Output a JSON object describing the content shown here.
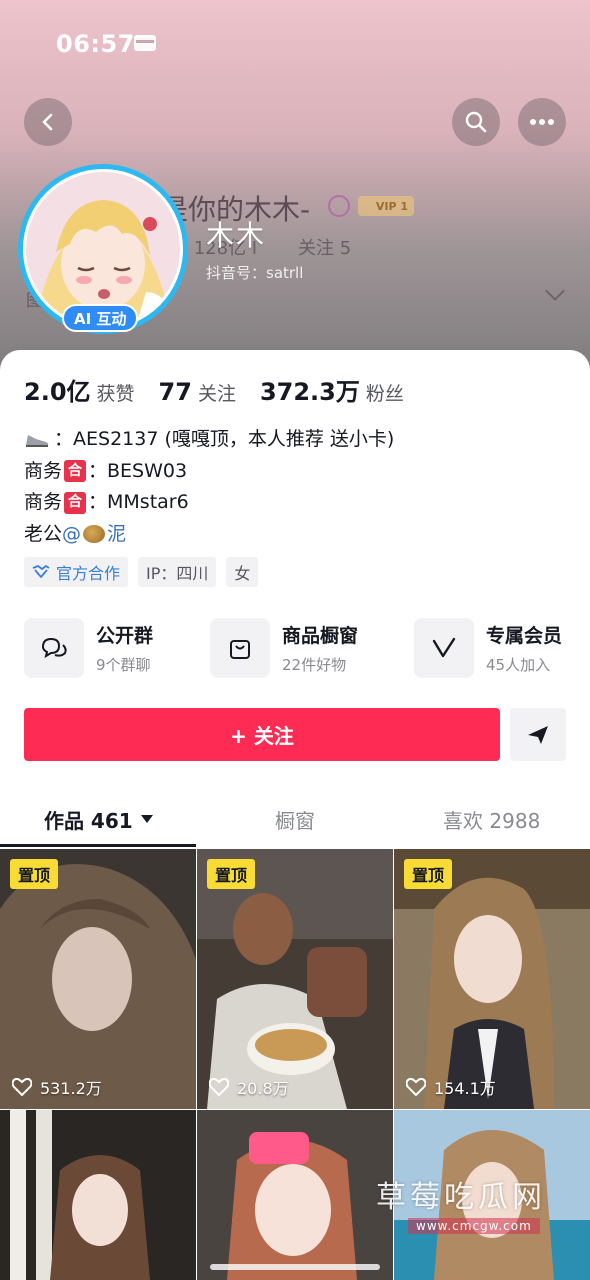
{
  "status_bar": {
    "time": "06:57"
  },
  "header": {
    "overlay_name": "木木",
    "ghost_name": "是你的木木-",
    "ghost_vip": "VIP 1",
    "ghost_stats": "丝 128亿 I",
    "ghost_follow": "关注 5",
    "ghost_id": "抖音号：satrll",
    "ghost_row": "图                   谢喜欢"
  },
  "avatar": {
    "ai_badge": "AI 互动"
  },
  "stats": [
    {
      "value": "2.0亿",
      "label": "获赞"
    },
    {
      "value": "77",
      "label": "关注"
    },
    {
      "value": "372.3万",
      "label": "粉丝"
    }
  ],
  "bio": {
    "line1": "：AES2137 (嘎嘎顶，本人推荐 送小卡)",
    "line2_prefix": "商务",
    "line2_badge": "合",
    "line2_text": "：BESW03",
    "line3_prefix": "商务",
    "line3_badge": "合",
    "line3_text": "：MMstar6",
    "line4_prefix": "老公",
    "line4_mention": "@",
    "line4_suffix": "泥"
  },
  "tags": {
    "official": "官方合作",
    "ip": "IP：四川",
    "gender": "女"
  },
  "services": [
    {
      "title": "公开群",
      "sub": "9个群聊",
      "icon": "chat-icon"
    },
    {
      "title": "商品橱窗",
      "sub": "22件好物",
      "icon": "shopping-bag-icon"
    },
    {
      "title": "专属会员",
      "sub": "45人加入",
      "icon": "v-member-icon"
    }
  ],
  "actions": {
    "follow": "+ 关注"
  },
  "tabs": {
    "works": "作品 461",
    "showcase": "橱窗",
    "likes": "喜欢 2988"
  },
  "videos": [
    {
      "pinned": "置顶",
      "likes": "531.2万"
    },
    {
      "pinned": "置顶",
      "likes": "20.8万"
    },
    {
      "pinned": "置顶",
      "likes": "154.1万"
    },
    {
      "pinned": "",
      "likes": ""
    },
    {
      "pinned": "",
      "likes": ""
    },
    {
      "pinned": "",
      "likes": ""
    }
  ],
  "watermark": {
    "text": "草莓吃瓜网",
    "url": "www.cmcgw.com"
  },
  "colors": {
    "follow": "#fe2c55",
    "pin": "#f8dc35",
    "ai_badge": "#2f8cf5",
    "avatar_ring": "#2eb8f0"
  }
}
